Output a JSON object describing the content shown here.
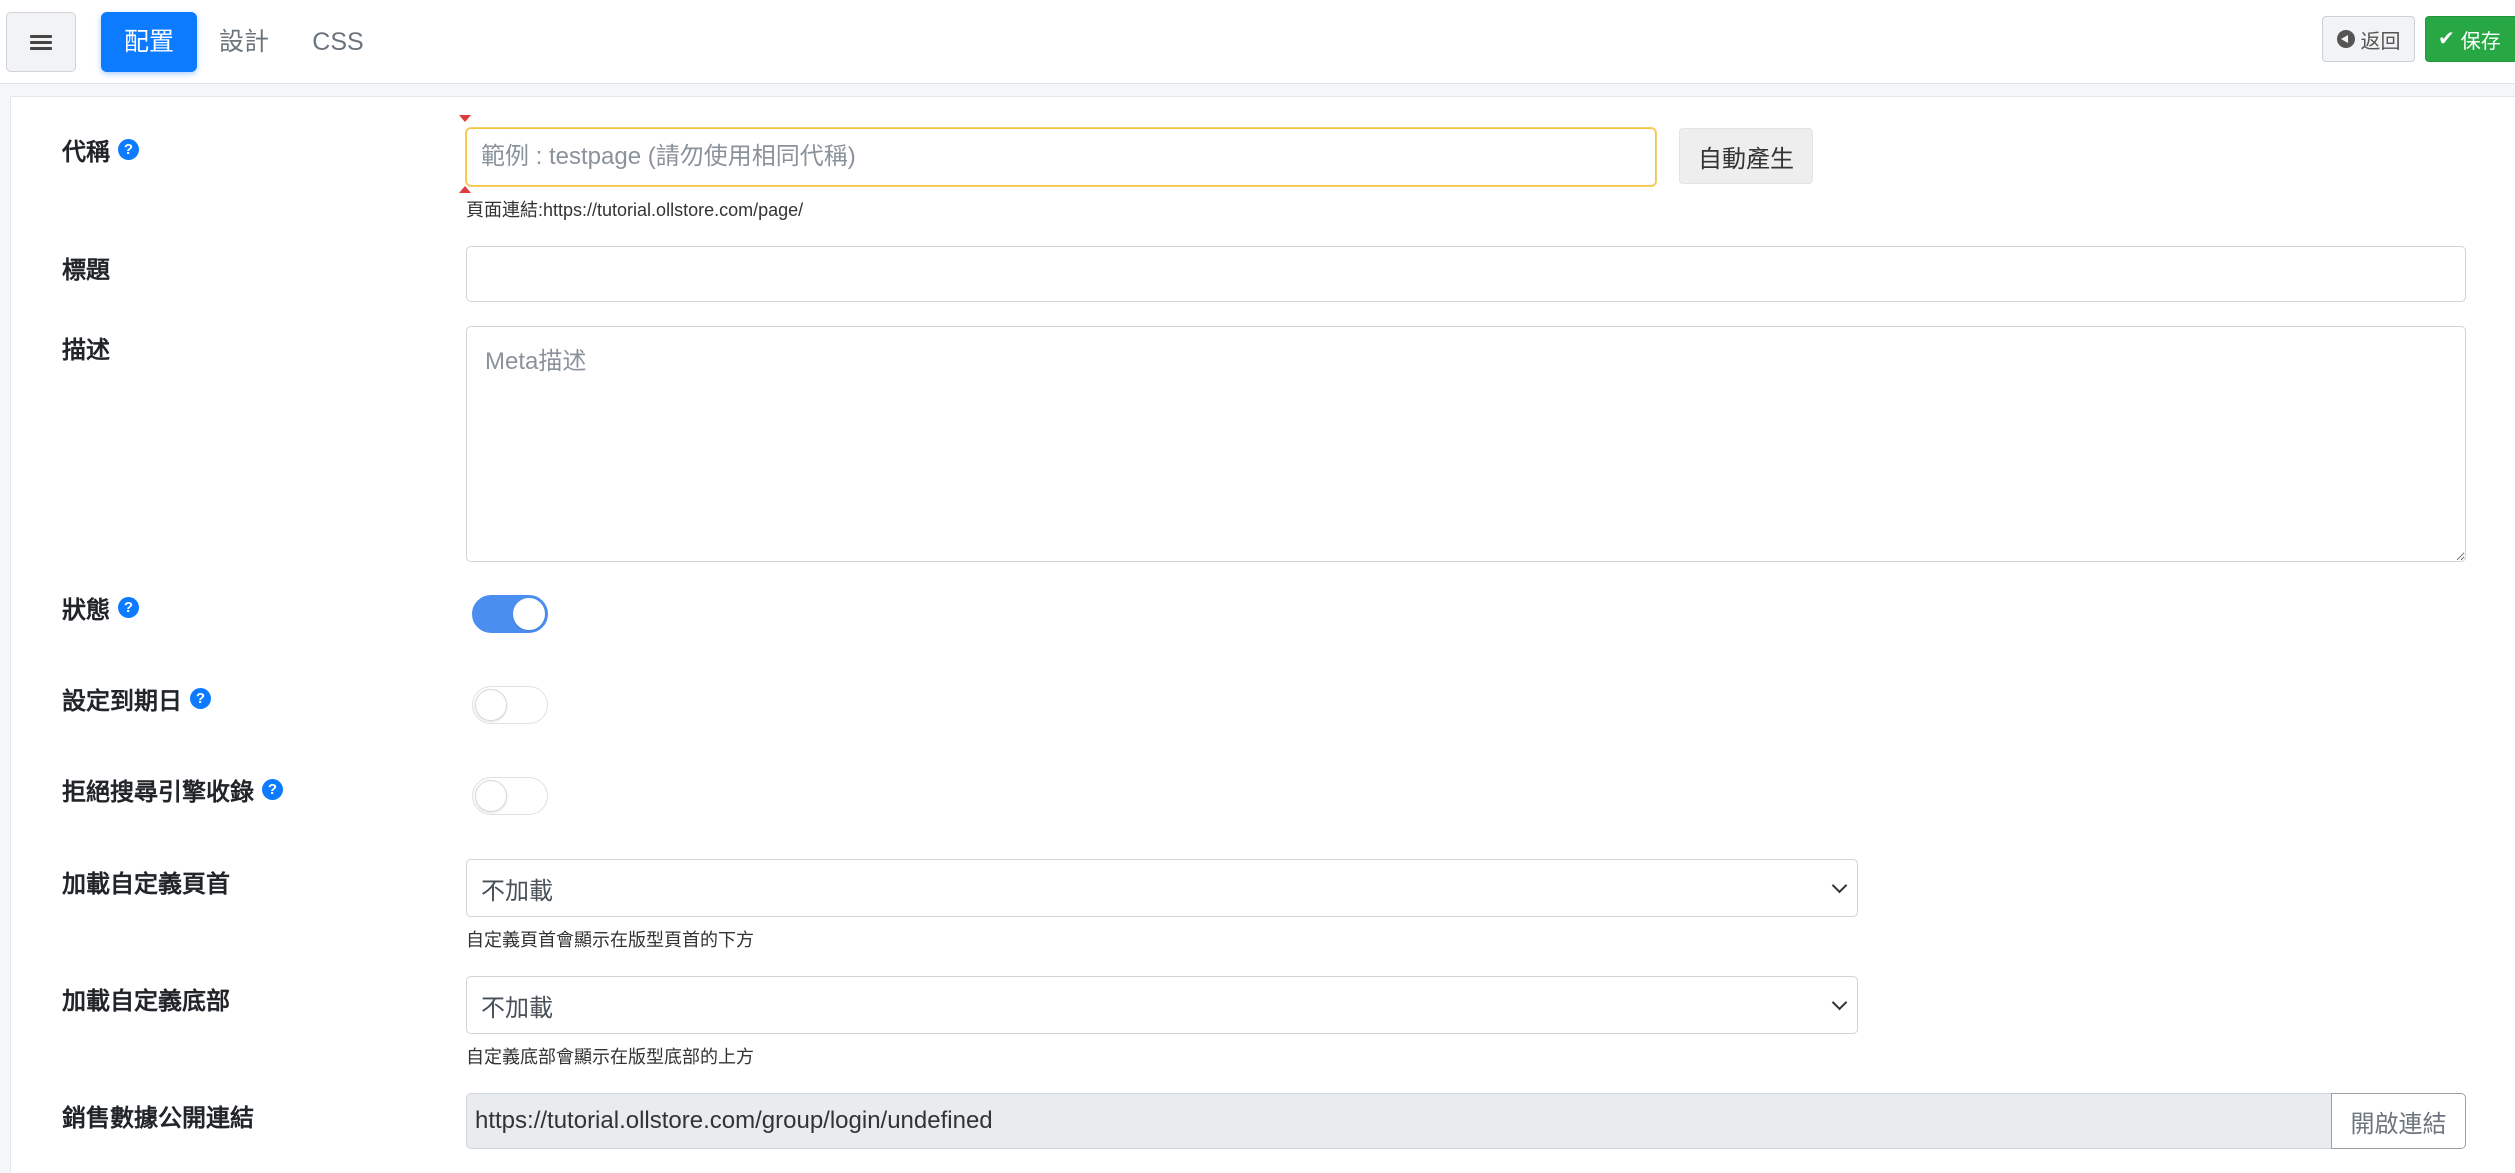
{
  "colors": {
    "primary": "#0d7bff",
    "success": "#28a745",
    "switch_on": "#4a8ff0",
    "focus_border": "#f5c542"
  },
  "toolbar": {
    "menu_icon": "hamburger-icon",
    "tabs": [
      {
        "label": "配置",
        "active": true
      },
      {
        "label": "設計",
        "active": false
      },
      {
        "label": "CSS",
        "active": false
      }
    ],
    "back_label": "返回",
    "back_icon": "arrow-circle-left-icon",
    "save_label": "保存",
    "save_icon": "check-icon"
  },
  "form": {
    "slug": {
      "label": "代稱",
      "placeholder": "範例 : testpage (請勿使用相同代稱)",
      "value": "",
      "auto_button": "自動產生",
      "help": "頁面連結:https://tutorial.ollstore.com/page/"
    },
    "title": {
      "label": "標題",
      "value": ""
    },
    "description": {
      "label": "描述",
      "placeholder": "Meta描述",
      "value": ""
    },
    "status": {
      "label": "狀態",
      "on": true
    },
    "expiry": {
      "label": "設定到期日",
      "on": false
    },
    "noindex": {
      "label": "拒絕搜尋引擎收錄",
      "on": false
    },
    "custom_header": {
      "label": "加載自定義頁首",
      "selected": "不加載",
      "help": "自定義頁首會顯示在版型頁首的下方"
    },
    "custom_footer": {
      "label": "加載自定義底部",
      "selected": "不加載",
      "help": "自定義底部會顯示在版型底部的上方"
    },
    "sales_link": {
      "label": "銷售數據公開連結",
      "value": "https://tutorial.ollstore.com/group/login/undefined",
      "open_button": "開啟連結"
    }
  }
}
